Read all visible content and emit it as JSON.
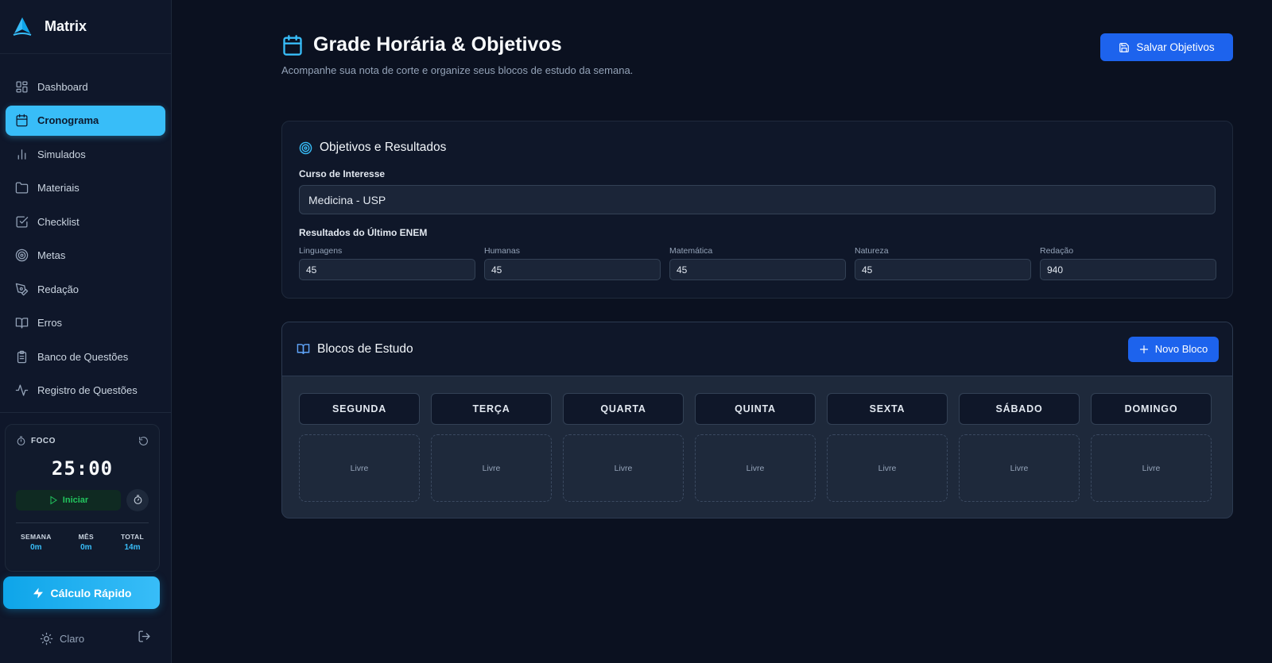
{
  "brand": {
    "name": "Matrix"
  },
  "nav": [
    {
      "label": "Dashboard",
      "icon": "dashboard-icon",
      "active": false
    },
    {
      "label": "Cronograma",
      "icon": "calendar-icon",
      "active": true
    },
    {
      "label": "Simulados",
      "icon": "bar-chart-icon",
      "active": false
    },
    {
      "label": "Materiais",
      "icon": "folder-icon",
      "active": false
    },
    {
      "label": "Checklist",
      "icon": "checkbox-icon",
      "active": false
    },
    {
      "label": "Metas",
      "icon": "target-icon",
      "active": false
    },
    {
      "label": "Redação",
      "icon": "pen-icon",
      "active": false
    },
    {
      "label": "Erros",
      "icon": "book-icon",
      "active": false
    },
    {
      "label": "Banco de Questões",
      "icon": "clipboard-icon",
      "active": false
    },
    {
      "label": "Registro de Questões",
      "icon": "activity-icon",
      "active": false
    }
  ],
  "focus": {
    "title": "FOCO",
    "timer": "25:00",
    "start_label": "Iniciar",
    "stats": [
      {
        "label": "SEMANA",
        "value": "0m"
      },
      {
        "label": "MÊS",
        "value": "0m"
      },
      {
        "label": "TOTAL",
        "value": "14m"
      }
    ]
  },
  "quick_calc": {
    "label": "Cálculo Rápido"
  },
  "theme": {
    "label": "Claro"
  },
  "header": {
    "title": "Grade Horária & Objetivos",
    "subtitle": "Acompanhe sua nota de corte e organize seus blocos de estudo da semana.",
    "save_label": "Salvar Objetivos"
  },
  "goals": {
    "title": "Objetivos e Resultados",
    "course_label": "Curso de Interesse",
    "course_value": "Medicina - USP",
    "scores_label": "Resultados do Último ENEM",
    "scores": [
      {
        "label": "Linguagens",
        "value": "45"
      },
      {
        "label": "Humanas",
        "value": "45"
      },
      {
        "label": "Matemática",
        "value": "45"
      },
      {
        "label": "Natureza",
        "value": "45"
      },
      {
        "label": "Redação",
        "value": "940"
      }
    ]
  },
  "blocks": {
    "title": "Blocos de Estudo",
    "new_label": "Novo Bloco",
    "days": [
      {
        "name": "SEGUNDA",
        "slot": "Livre"
      },
      {
        "name": "TERÇA",
        "slot": "Livre"
      },
      {
        "name": "QUARTA",
        "slot": "Livre"
      },
      {
        "name": "QUINTA",
        "slot": "Livre"
      },
      {
        "name": "SEXTA",
        "slot": "Livre"
      },
      {
        "name": "SÁBADO",
        "slot": "Livre"
      },
      {
        "name": "DOMINGO",
        "slot": "Livre"
      }
    ]
  },
  "colors": {
    "accent": "#38bdf8",
    "primary_button": "#1d63ed",
    "background": "#0b1120",
    "sidebar": "#0f172a",
    "start_green": "#22c55e"
  }
}
